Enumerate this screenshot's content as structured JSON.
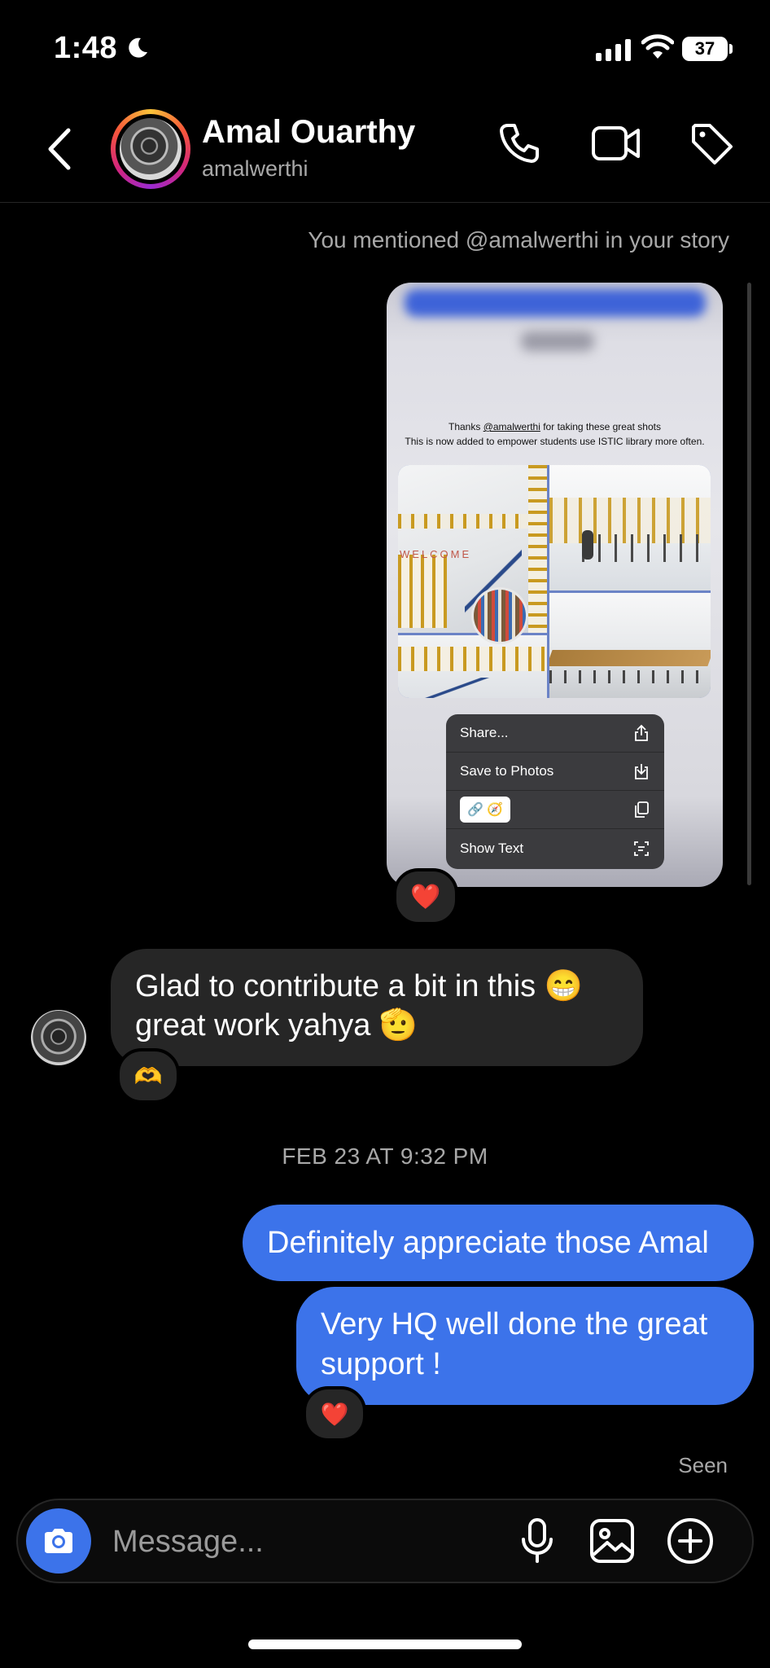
{
  "status_bar": {
    "time": "1:48",
    "battery": "37"
  },
  "header": {
    "name": "Amal Ouarthy",
    "handle": "amalwerthi"
  },
  "story": {
    "notice": "You mentioned @amalwerthi in your story",
    "caption_pre": "Thanks ",
    "caption_mention": "@amalwerthi",
    "caption_post": " for taking these great shots",
    "caption_line2": "This is now added to empower students use ISTIC library more often.",
    "menu": {
      "share": "Share...",
      "save": "Save to Photos",
      "show_text": "Show Text"
    },
    "reaction": "❤️"
  },
  "messages": {
    "incoming_line1": "Glad to contribute a bit in this 😁",
    "incoming_line2": "great work yahya 🫡",
    "incoming_reaction": "🫶",
    "timestamp": "FEB 23 AT 9:32 PM",
    "outgoing_1": "Definitely appreciate those Amal",
    "outgoing_2_line1": "Very HQ well done the great",
    "outgoing_2_line2": "support !",
    "outgoing_reaction": "❤️",
    "seen": "Seen"
  },
  "composer": {
    "placeholder": "Message..."
  },
  "colors": {
    "accent": "#3c73ea",
    "bubble_in": "#262626",
    "background": "#000000"
  },
  "icons": [
    "moon-icon",
    "signal-icon",
    "wifi-icon",
    "back-icon",
    "phone-icon",
    "video-icon",
    "tag-icon",
    "share-icon",
    "save-icon",
    "copy-icon",
    "scan-text-icon",
    "camera-icon",
    "microphone-icon",
    "gallery-icon",
    "plus-icon"
  ]
}
